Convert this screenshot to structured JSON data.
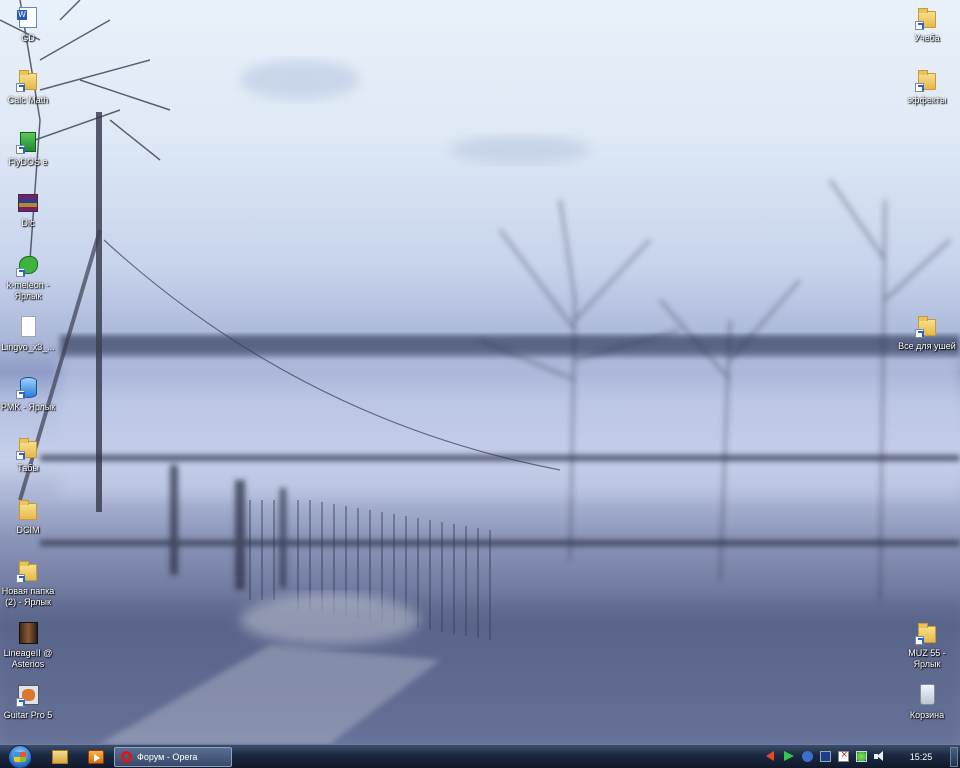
{
  "desktop": {
    "left_icons": [
      {
        "label": "GD",
        "icon": "word-document-icon"
      },
      {
        "label": "Calc Math",
        "icon": "folder-icon"
      },
      {
        "label": "FlyDOS e",
        "icon": "game-shortcut-icon"
      },
      {
        "label": "Dic",
        "icon": "winrar-archive-icon"
      },
      {
        "label": "k-meleon - Ярлык",
        "icon": "kmeleon-browser-icon"
      },
      {
        "label": "Lingvo_x3_...",
        "icon": "document-icon"
      },
      {
        "label": "PMK - Ярлык",
        "icon": "pmk-app-icon"
      },
      {
        "label": "Табы",
        "icon": "folder-icon"
      },
      {
        "label": "DCIM",
        "icon": "folder-icon"
      },
      {
        "label": "Новая папка (2) - Ярлык",
        "icon": "folder-icon"
      },
      {
        "label": "LineageII @ Asterios",
        "icon": "lineage-game-icon"
      },
      {
        "label": "Guitar Pro 5",
        "icon": "guitar-pro-icon"
      }
    ],
    "right_icons": [
      {
        "label": "Учеба",
        "icon": "folder-icon"
      },
      {
        "label": "эффекты",
        "icon": "folder-icon"
      },
      {
        "label": "Все для ушей",
        "icon": "folder-icon"
      },
      {
        "label": "MUZ 55 - Ярлык",
        "icon": "folder-icon"
      },
      {
        "label": "Корзина",
        "icon": "recycle-bin-icon"
      }
    ]
  },
  "taskbar": {
    "start_icon": "windows-orb-icon",
    "quick_launch": [
      "explorer-icon",
      "media-player-icon"
    ],
    "active_task": {
      "label": "Форум - Opera",
      "icon": "opera-icon"
    },
    "clock": "15:25"
  }
}
